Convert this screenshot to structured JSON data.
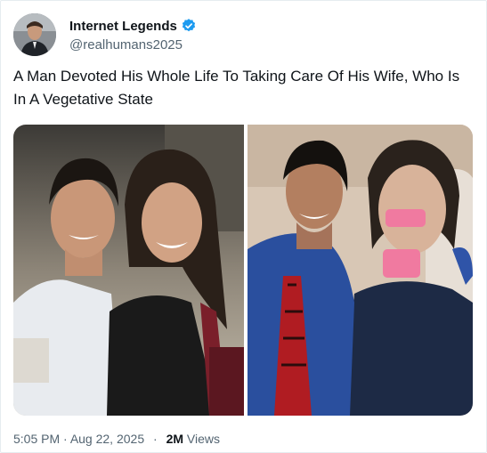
{
  "author": {
    "display_name": "Internet Legends",
    "handle": "@realhumans2025",
    "verified_icon": "verified-badge-icon",
    "verified_color": "#1d9bf0"
  },
  "tweet": {
    "text": "A Man Devoted His Whole Life To Taking Care Of His Wife, Who Is In A Vegetative State"
  },
  "media": {
    "photos": [
      "couple-before-photo",
      "couple-after-photo"
    ]
  },
  "footer": {
    "time": "5:05 PM",
    "separator": "·",
    "date": "Aug 22, 2025",
    "views_count": "2M",
    "views_label": "Views"
  },
  "colors": {
    "text_primary": "#0f1419",
    "text_secondary": "#536471",
    "accent": "#1d9bf0"
  }
}
